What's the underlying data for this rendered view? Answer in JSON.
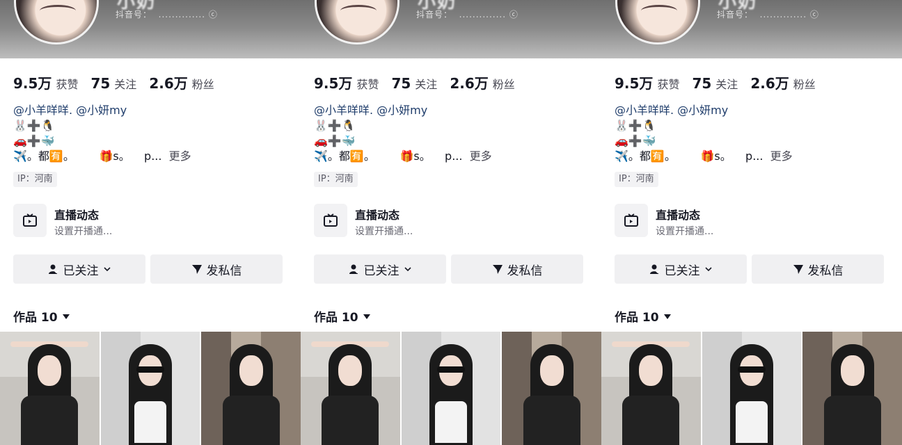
{
  "profile": {
    "name_partial": "小奶",
    "douyin_id": "抖音号：  .............. ⓒ",
    "stats": [
      {
        "num": "9.5万",
        "label": "获赞"
      },
      {
        "num": "75",
        "label": "关注"
      },
      {
        "num": "2.6万",
        "label": "粉丝"
      }
    ],
    "bio_mentions": "@小羊咩咩. @小妍my",
    "bio_line2": "🐰➕🐧",
    "bio_line3": "🚗➕🐳",
    "bio_line4": "✈️。都🈶。       🎁s。    p...",
    "more_label": "更多",
    "ip": "IP：河南"
  },
  "live": {
    "title": "直播动态",
    "subtitle": "设置开播通..."
  },
  "actions": {
    "follow": "已关注",
    "message": "发私信"
  },
  "works": {
    "label": "作品 10"
  },
  "colors": {
    "link": "#1f3d6b",
    "text": "#161823",
    "button_bg": "#f0f0f2"
  }
}
